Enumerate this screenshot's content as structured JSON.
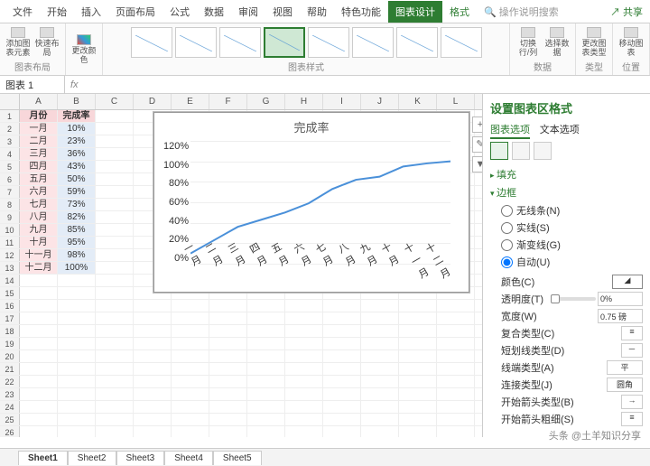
{
  "tabs": [
    "文件",
    "开始",
    "插入",
    "页面布局",
    "公式",
    "数据",
    "审阅",
    "视图",
    "帮助",
    "特色功能",
    "图表设计",
    "格式"
  ],
  "activeTab": 10,
  "searchHint": "操作说明搜索",
  "share": "共享",
  "ribbon": {
    "layout": {
      "label": "图表布局",
      "btn1": "添加图表元素",
      "btn2": "快速布局"
    },
    "color": {
      "label": "",
      "btn": "更改颜色"
    },
    "styles": {
      "label": "图表样式"
    },
    "data": {
      "label": "数据",
      "btn1": "切换行/列",
      "btn2": "选择数据"
    },
    "type": {
      "label": "类型",
      "btn": "更改图表类型"
    },
    "pos": {
      "label": "位置",
      "btn": "移动图表"
    }
  },
  "nameBox": "图表 1",
  "cols": [
    "A",
    "B",
    "C",
    "D",
    "E",
    "F",
    "G",
    "H",
    "I",
    "J",
    "K",
    "L"
  ],
  "table": {
    "headers": [
      "月份",
      "完成率"
    ],
    "rows": [
      [
        "一月",
        "10%"
      ],
      [
        "二月",
        "23%"
      ],
      [
        "三月",
        "36%"
      ],
      [
        "四月",
        "43%"
      ],
      [
        "五月",
        "50%"
      ],
      [
        "六月",
        "59%"
      ],
      [
        "七月",
        "73%"
      ],
      [
        "八月",
        "82%"
      ],
      [
        "九月",
        "85%"
      ],
      [
        "十月",
        "95%"
      ],
      [
        "十一月",
        "98%"
      ],
      [
        "十二月",
        "100%"
      ]
    ]
  },
  "chart_data": {
    "type": "line",
    "title": "完成率",
    "categories": [
      "一月",
      "二月",
      "三月",
      "四月",
      "五月",
      "六月",
      "七月",
      "八月",
      "九月",
      "十月",
      "十一月",
      "十二月"
    ],
    "values": [
      10,
      23,
      36,
      43,
      50,
      59,
      73,
      82,
      85,
      95,
      98,
      100
    ],
    "ylim": [
      0,
      120
    ],
    "yticks": [
      "120%",
      "100%",
      "80%",
      "60%",
      "40%",
      "20%",
      "0%"
    ],
    "xlabel": "",
    "ylabel": ""
  },
  "sideButtons": [
    "+",
    "✎",
    "▼"
  ],
  "panel": {
    "title": "设置图表区格式",
    "tabs": [
      "图表选项",
      "文本选项"
    ],
    "fill": "填充",
    "border": "边框",
    "borderOpts": [
      "无线条(N)",
      "实线(S)",
      "渐变线(G)",
      "自动(U)"
    ],
    "borderSel": 3,
    "props": {
      "color": "颜色(C)",
      "trans": "透明度(T)",
      "transVal": "0%",
      "width": "宽度(W)",
      "widthVal": "0.75 磅",
      "compound": "复合类型(C)",
      "dash": "短划线类型(D)",
      "cap": "线端类型(A)",
      "capVal": "平",
      "join": "连接类型(J)",
      "joinVal": "圆角",
      "arrowBegin": "开始箭头类型(B)",
      "arrowBeginSize": "开始箭头粗细(S)"
    }
  },
  "sheets": [
    "Sheet1",
    "Sheet2",
    "Sheet3",
    "Sheet4",
    "Sheet5"
  ],
  "activeSheet": 0,
  "watermark": "头条 @土羊知识分享"
}
